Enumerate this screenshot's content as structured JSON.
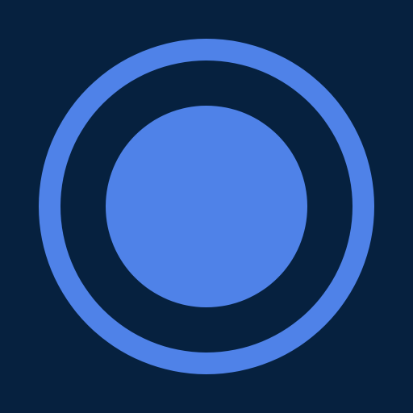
{
  "canvas": {
    "background_color": "#06213f"
  },
  "icon": {
    "name": "record-target-icon",
    "accent_color": "#4f82e8",
    "background_color": "#06213f"
  }
}
